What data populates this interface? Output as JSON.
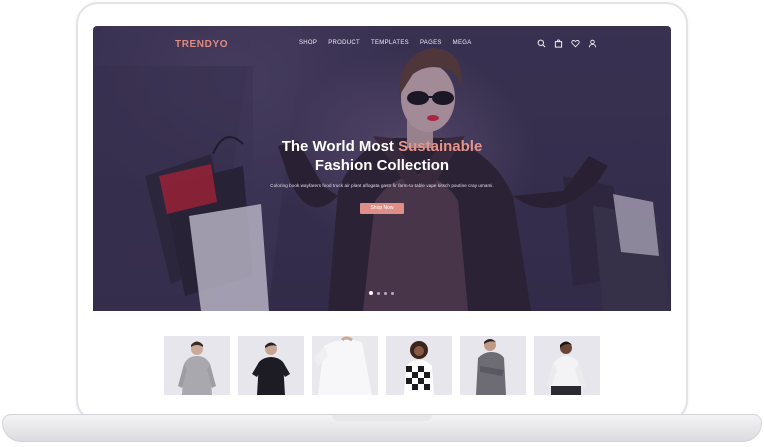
{
  "brand": {
    "name": "TRENDYO",
    "color": "#e08a80"
  },
  "nav": {
    "items": [
      "SHOP",
      "PRODUCT",
      "TEMPLATES",
      "PAGES",
      "MEGA"
    ],
    "icons": [
      "search-icon",
      "cart-icon",
      "heart-icon",
      "user-icon"
    ]
  },
  "hero": {
    "headline_part1": "The World Most ",
    "headline_accent": "Sustainable",
    "headline_line2": "Fashion Collection",
    "subtext": "Coloring book wayfarers food truck air plant aflogata gastr fir farm-to-table vape kitsch poutine cray umami.",
    "cta_label": "Shop Now",
    "slides": 4,
    "active_slide": 1,
    "accent_color": "#e4948a"
  },
  "products": [
    {
      "name": "grey-sweater-product"
    },
    {
      "name": "black-tee-product"
    },
    {
      "name": "white-shirt-product"
    },
    {
      "name": "plaid-shirt-product"
    },
    {
      "name": "grey-shirt-product"
    },
    {
      "name": "white-top-product"
    }
  ]
}
